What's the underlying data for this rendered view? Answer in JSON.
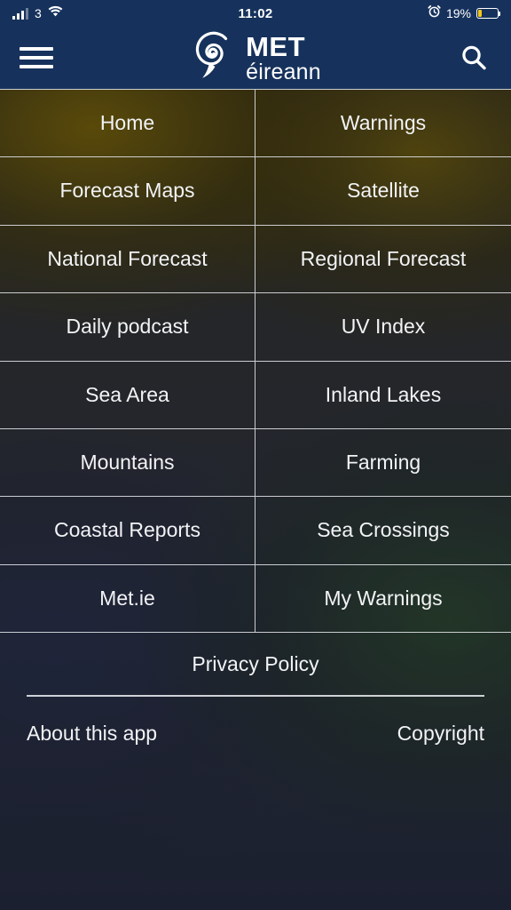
{
  "status_bar": {
    "carrier": "3",
    "signal_icon": "signal-bars-icon",
    "wifi_icon": "wifi-icon",
    "time": "11:02",
    "alarm_icon": "alarm-clock-icon",
    "battery_percent": "19%",
    "battery_level": 19,
    "battery_icon": "battery-low-icon"
  },
  "header": {
    "menu_icon": "hamburger-menu-icon",
    "logo_icon": "met-eireann-spiral-logo-icon",
    "brand_primary": "MET",
    "brand_secondary": "éireann",
    "search_icon": "search-icon"
  },
  "menu": {
    "items": [
      {
        "label": "Home"
      },
      {
        "label": "Warnings"
      },
      {
        "label": "Forecast Maps"
      },
      {
        "label": "Satellite"
      },
      {
        "label": "National Forecast"
      },
      {
        "label": "Regional Forecast"
      },
      {
        "label": "Daily podcast"
      },
      {
        "label": "UV Index"
      },
      {
        "label": "Sea Area"
      },
      {
        "label": "Inland Lakes"
      },
      {
        "label": "Mountains"
      },
      {
        "label": "Farming"
      },
      {
        "label": "Coastal Reports"
      },
      {
        "label": "Sea Crossings"
      },
      {
        "label": "Met.ie"
      },
      {
        "label": "My Warnings"
      }
    ]
  },
  "footer": {
    "privacy_policy": "Privacy Policy",
    "about": "About this app",
    "copyright": "Copyright"
  },
  "colors": {
    "header_navy": "#16325c",
    "page_navy": "#1b2030",
    "grid_line": "#e1e4e8",
    "text": "#f2f3f5",
    "battery_amber": "#f5c518"
  }
}
